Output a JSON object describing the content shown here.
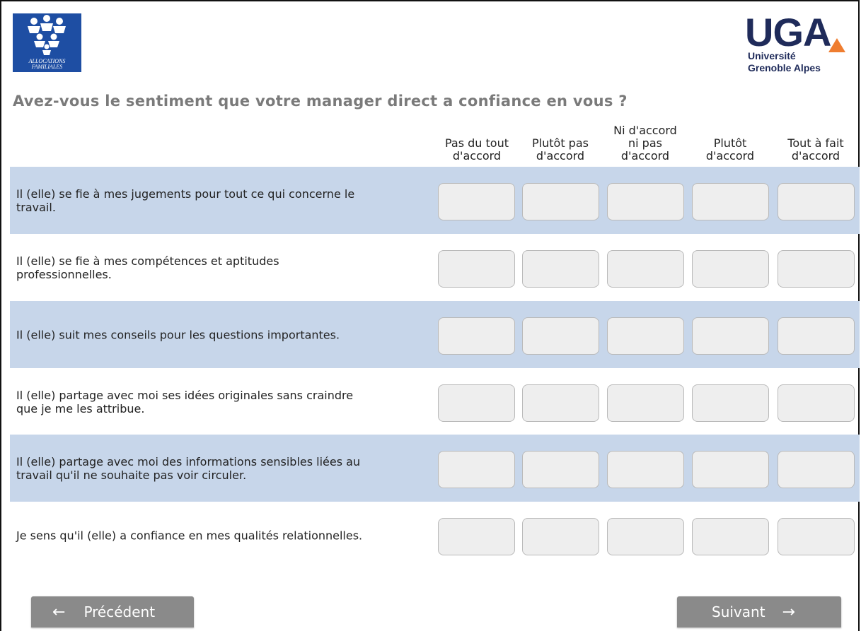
{
  "logos": {
    "caf": {
      "line1": "ALLOCATIONS",
      "line2": "FAMILIALES",
      "color": "#1e4ea3"
    },
    "uga": {
      "word": "UGA",
      "sub1": "Université",
      "sub2": "Grenoble Alpes",
      "accent": "#ef7d30",
      "color": "#1f2b5a"
    }
  },
  "question": "Avez-vous le sentiment que votre manager direct a confiance en vous ?",
  "columns": [
    "Pas du tout\nd'accord",
    "Plutôt pas\nd'accord",
    "Ni d'accord\nni pas\nd'accord",
    "Plutôt\nd'accord",
    "Tout à fait\nd'accord"
  ],
  "rows": [
    "Il (elle) se fie à mes jugements pour tout ce qui concerne le\ntravail.",
    "Il (elle) se fie à mes compétences et aptitudes\nprofessionnelles.",
    "Il (elle) suit mes conseils pour les questions importantes.",
    "Il (elle) partage avec moi ses idées originales sans craindre\nque je me les attribue.",
    "Il (elle) partage avec moi des informations sensibles liées au\ntravail qu'il ne souhaite pas voir circuler.",
    "Je sens qu'il (elle) a confiance en mes qualités relationnelles."
  ],
  "nav": {
    "prev_label": "Précédent",
    "next_label": "Suivant",
    "prev_icon": "arrow-left-icon",
    "next_icon": "arrow-right-icon"
  },
  "colors": {
    "row_shade": "#c7d6ea",
    "question": "#7a7a7a",
    "button": "#8a8a8a"
  }
}
